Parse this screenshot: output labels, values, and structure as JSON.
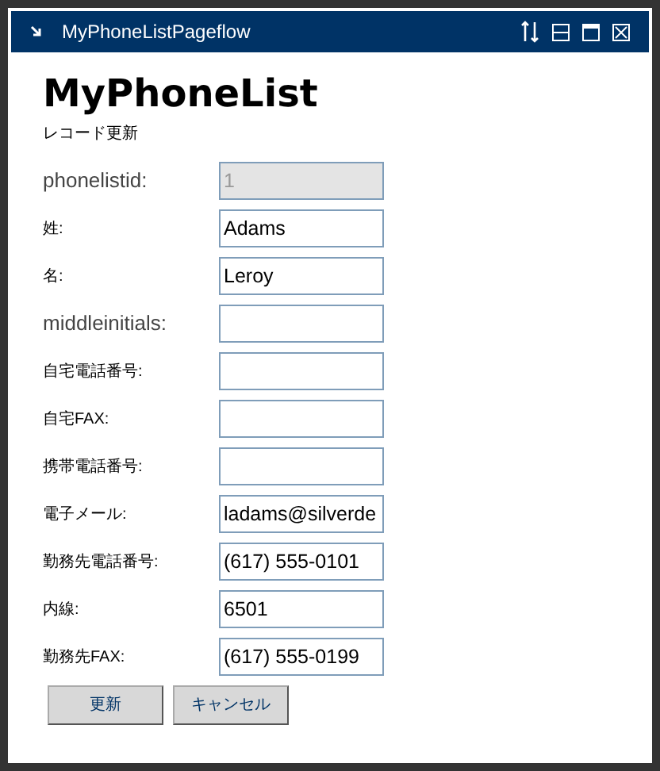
{
  "window": {
    "title": "MyPhoneListPageflow"
  },
  "heading": "MyPhoneList",
  "subtitle": "レコード更新",
  "fields": [
    {
      "label": "phonelistid:",
      "value": "1",
      "disabled": true,
      "kind": "latin"
    },
    {
      "label": "姓:",
      "value": "Adams",
      "disabled": false,
      "kind": "cjk"
    },
    {
      "label": "名:",
      "value": "Leroy",
      "disabled": false,
      "kind": "cjk"
    },
    {
      "label": "middleinitials:",
      "disabled": false,
      "kind": "latin"
    },
    {
      "label": "自宅電話番号:",
      "disabled": false,
      "kind": "cjk"
    },
    {
      "label": "自宅FAX:",
      "disabled": false,
      "kind": "cjk"
    },
    {
      "label": "携帯電話番号:",
      "disabled": false,
      "kind": "cjk"
    },
    {
      "label": "電子メール:",
      "value": "ladams@silverde",
      "disabled": false,
      "kind": "cjk"
    },
    {
      "label": "勤務先電話番号:",
      "value": "(617) 555-0101",
      "disabled": false,
      "kind": "cjk"
    },
    {
      "label": "内線:",
      "value": "6501",
      "disabled": false,
      "kind": "cjk"
    },
    {
      "label": "勤務先FAX:",
      "value": "(617) 555-0199",
      "disabled": false,
      "kind": "cjk"
    }
  ],
  "buttons": [
    "更新",
    "キャンセル"
  ]
}
